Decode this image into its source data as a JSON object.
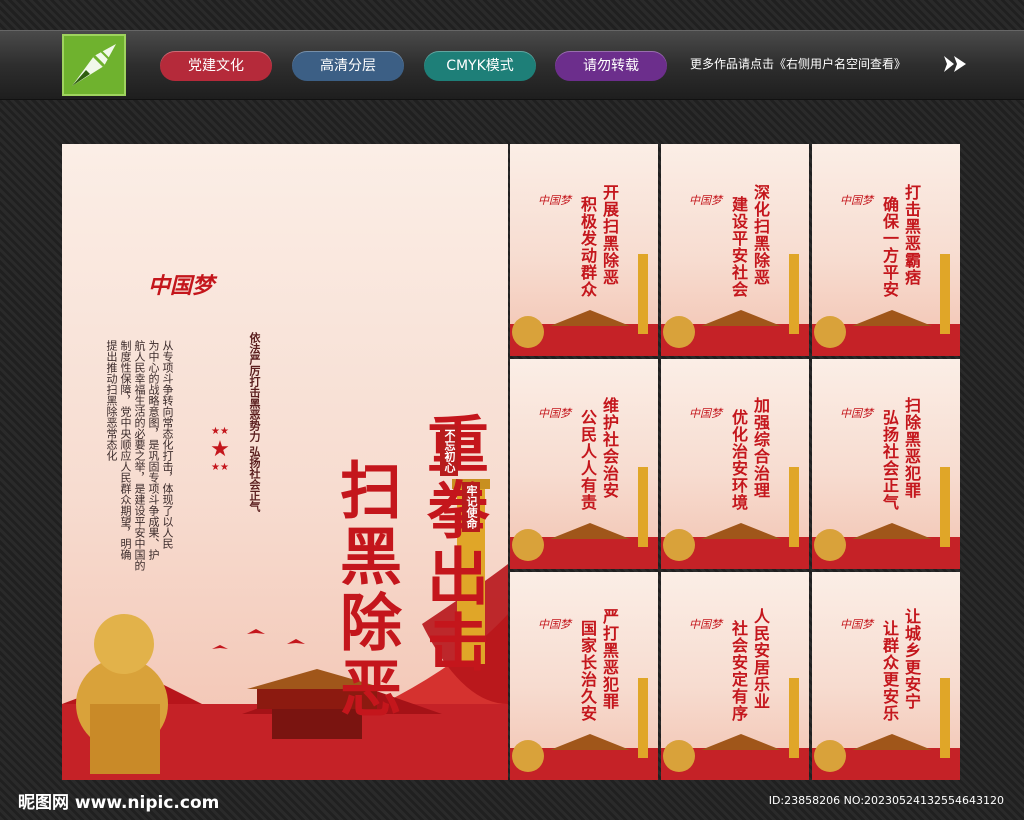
{
  "header": {
    "buttons": [
      {
        "label": "党建文化",
        "color": "#b52a3a"
      },
      {
        "label": "高清分层",
        "color": "#3c5f85"
      },
      {
        "label": "CMYK模式",
        "color": "#1e7f78"
      },
      {
        "label": "请勿转载",
        "color": "#6c2e8c"
      }
    ],
    "tagline": "更多作品请点击《右侧用户名空间查看》"
  },
  "main_poster": {
    "china_dream": "中国梦",
    "title_line1": "重拳出击",
    "title_line2": "扫黑除恶",
    "subtitle": "依法严厉打击黑恶势力 弘扬社会正气",
    "body": [
      "从专项斗争转向常态化打击，体现了以人民",
      "为中心的战略意图，是巩固专项斗争成果、护",
      "航人民幸福生活的必要之举，是建设平安中国的",
      "制度性保障，党中央顺应人民群众期望，明确",
      "提出推动扫黑除恶常态化"
    ],
    "seal_1": "不忘初心",
    "seal_2": "牢记使命"
  },
  "small_posters": [
    {
      "line1": "开展扫黑除恶",
      "line2": "积极发动群众"
    },
    {
      "line1": "深化扫黑除恶",
      "line2": "建设平安社会"
    },
    {
      "line1": "打击黑恶霸痞",
      "line2": "确保一方平安"
    },
    {
      "line1": "维护社会治安",
      "line2": "公民人人有责"
    },
    {
      "line1": "加强综合治理",
      "line2": "优化治安环境"
    },
    {
      "line1": "扫除黑恶犯罪",
      "line2": "弘扬社会正气"
    },
    {
      "line1": "严打黑恶犯罪",
      "line2": "国家长治久安"
    },
    {
      "line1": "人民安居乐业",
      "line2": "社会安定有序"
    },
    {
      "line1": "让城乡更安宁",
      "line2": "让群众更安乐"
    }
  ],
  "footer": {
    "watermark": "昵图网 www.nipic.com",
    "id_text": "ID:23858206 NO:20230524132554643120"
  },
  "colors": {
    "accent_red": "#c4161c",
    "gold": "#e0a628"
  }
}
